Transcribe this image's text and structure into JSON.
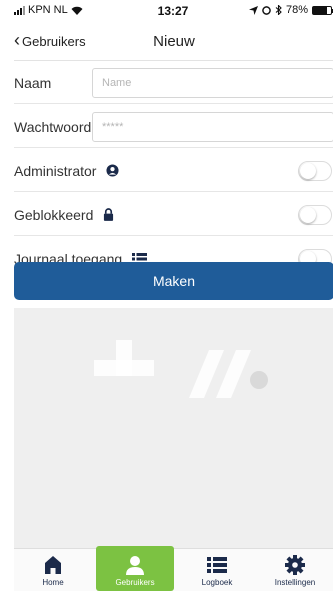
{
  "status": {
    "carrier": "KPN NL",
    "time": "13:27",
    "battery": "78%",
    "battery_level": 0.78
  },
  "nav": {
    "back_label": "Gebruikers",
    "title": "Nieuw"
  },
  "form": {
    "name_label": "Naam",
    "name_placeholder": "Name",
    "name_value": "",
    "password_label": "Wachtwoord",
    "password_placeholder": "*****",
    "toggles": [
      {
        "label": "Administrator",
        "icon": "user-shield-icon",
        "on": false
      },
      {
        "label": "Geblokkeerd",
        "icon": "lock-icon",
        "on": false
      },
      {
        "label": "Journaal toegang",
        "icon": "list-icon",
        "on": false
      }
    ],
    "submit_label": "Maken"
  },
  "tabs": [
    {
      "label": "Home",
      "icon": "home-icon",
      "active": false
    },
    {
      "label": "Gebruikers",
      "icon": "user-icon",
      "active": true
    },
    {
      "label": "Logboek",
      "icon": "list-icon",
      "active": false
    },
    {
      "label": "Instellingen",
      "icon": "gear-icon",
      "active": false
    }
  ],
  "colors": {
    "primary": "#1f5c99",
    "active_tab": "#7cc242",
    "icon_dark": "#1b2a4a"
  }
}
